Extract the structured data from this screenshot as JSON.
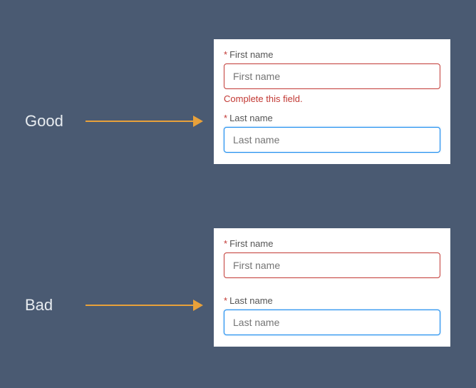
{
  "labels": {
    "good": "Good",
    "bad": "Bad"
  },
  "good_card": {
    "first_label": "First name",
    "first_placeholder": "First name",
    "error_msg": "Complete this field.",
    "last_label": "Last name",
    "last_placeholder": "Last name"
  },
  "bad_card": {
    "first_label": "First name",
    "first_placeholder": "First name",
    "last_label": "Last name",
    "last_placeholder": "Last name"
  },
  "required_mark": "*"
}
